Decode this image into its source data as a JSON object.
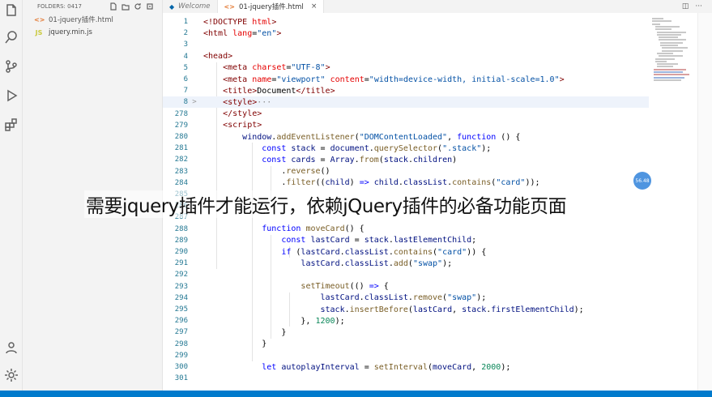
{
  "activity_bar": {
    "icons": [
      "explorer-icon",
      "search-icon",
      "source-control-icon",
      "run-debug-icon",
      "extensions-icon",
      "accounts-icon",
      "settings-gear-icon"
    ]
  },
  "sidebar": {
    "header": "FOLDERS: 0417",
    "files": [
      {
        "name": "01-jquery插件.html",
        "type": "html",
        "icon": "<>"
      },
      {
        "name": "jquery.min.js",
        "type": "js",
        "icon": "JS"
      }
    ]
  },
  "tabs": [
    {
      "label": "Welcome",
      "icon": "vscode-icon",
      "active": false
    },
    {
      "label": "01-jquery插件.html",
      "icon": "html-file-icon",
      "active": true,
      "close": "×"
    }
  ],
  "tab_actions": [
    "◫",
    "···"
  ],
  "code_lines": [
    {
      "n": "1",
      "fold": "",
      "html": "<span class=\"tg\">&lt;!DOCTYPE</span> <span class=\"at\">html</span><span class=\"tg\">&gt;</span>"
    },
    {
      "n": "2",
      "fold": "",
      "html": "<span class=\"tg\">&lt;html</span> <span class=\"at\">lang</span>=<span class=\"st\">\"en\"</span><span class=\"tg\">&gt;</span>"
    },
    {
      "n": "3",
      "fold": "",
      "html": ""
    },
    {
      "n": "4",
      "fold": "",
      "html": "<span class=\"tg\">&lt;head&gt;</span>"
    },
    {
      "n": "5",
      "fold": "",
      "html": "    <span class=\"tg\">&lt;meta</span> <span class=\"at\">charset</span>=<span class=\"st\">\"UTF-8\"</span><span class=\"tg\">&gt;</span>"
    },
    {
      "n": "6",
      "fold": "",
      "html": "    <span class=\"tg\">&lt;meta</span> <span class=\"at\">name</span>=<span class=\"st\">\"viewport\"</span> <span class=\"at\">content</span>=<span class=\"st\">\"width=device-width, initial-scale=1.0\"</span><span class=\"tg\">&gt;</span>"
    },
    {
      "n": "7",
      "fold": "",
      "html": "    <span class=\"tg\">&lt;title&gt;</span>Document<span class=\"tg\">&lt;/title&gt;</span>"
    },
    {
      "n": "8",
      "fold": ">",
      "html": "    <span class=\"tg\">&lt;style&gt;</span><span class=\"el\">···</span>",
      "current": true
    },
    {
      "n": "278",
      "fold": "",
      "html": "    <span class=\"tg\">&lt;/style&gt;</span>"
    },
    {
      "n": "279",
      "fold": "",
      "html": "    <span class=\"tg\">&lt;script&gt;</span>"
    },
    {
      "n": "280",
      "fold": "",
      "html": "        <span class=\"vr\">window</span>.<span class=\"fn\">addEventListener</span>(<span class=\"st\">\"DOMContentLoaded\"</span>, <span class=\"kw\">function</span> () {"
    },
    {
      "n": "281",
      "fold": "",
      "html": "            <span class=\"kw\">const</span> <span class=\"vr\">stack</span> = <span class=\"vr\">document</span>.<span class=\"fn\">querySelector</span>(<span class=\"st\">\".stack\"</span>);"
    },
    {
      "n": "282",
      "fold": "",
      "html": "            <span class=\"kw\">const</span> <span class=\"vr\">cards</span> = <span class=\"vr\">Array</span>.<span class=\"fn\">from</span>(<span class=\"vr\">stack</span>.<span class=\"vr\">children</span>)"
    },
    {
      "n": "283",
      "fold": "",
      "html": "                .<span class=\"fn\">reverse</span>()"
    },
    {
      "n": "284",
      "fold": "",
      "html": "                .<span class=\"fn\">filter</span>((<span class=\"vr\">child</span>) <span class=\"kw\">=&gt;</span> <span class=\"vr\">child</span>.<span class=\"vr\">classList</span>.<span class=\"fn\">contains</span>(<span class=\"st\">\"card\"</span>));"
    },
    {
      "n": "285",
      "fold": "",
      "html": ""
    },
    {
      "n": "286",
      "fold": "",
      "html": ""
    },
    {
      "n": "287",
      "fold": "",
      "html": ""
    },
    {
      "n": "288",
      "fold": "",
      "html": "            <span class=\"kw\">function</span> <span class=\"fn\">moveCard</span>() {"
    },
    {
      "n": "289",
      "fold": "",
      "html": "                <span class=\"kw\">const</span> <span class=\"vr\">lastCard</span> = <span class=\"vr\">stack</span>.<span class=\"vr\">lastElementChild</span>;"
    },
    {
      "n": "290",
      "fold": "",
      "html": "                <span class=\"kw\">if</span> (<span class=\"vr\">lastCard</span>.<span class=\"vr\">classList</span>.<span class=\"fn\">contains</span>(<span class=\"st\">\"card\"</span>)) {"
    },
    {
      "n": "291",
      "fold": "",
      "html": "                    <span class=\"vr\">lastCard</span>.<span class=\"vr\">classList</span>.<span class=\"fn\">add</span>(<span class=\"st\">\"swap\"</span>);"
    },
    {
      "n": "292",
      "fold": "",
      "html": ""
    },
    {
      "n": "293",
      "fold": "",
      "html": "                    <span class=\"fn\">setTimeout</span>(() <span class=\"kw\">=&gt;</span> {"
    },
    {
      "n": "294",
      "fold": "",
      "html": "                        <span class=\"vr\">lastCard</span>.<span class=\"vr\">classList</span>.<span class=\"fn\">remove</span>(<span class=\"st\">\"swap\"</span>);"
    },
    {
      "n": "295",
      "fold": "",
      "html": "                        <span class=\"vr\">stack</span>.<span class=\"fn\">insertBefore</span>(<span class=\"vr\">lastCard</span>, <span class=\"vr\">stack</span>.<span class=\"vr\">firstElementChild</span>);"
    },
    {
      "n": "296",
      "fold": "",
      "html": "                    }, <span class=\"nm\">1200</span>);"
    },
    {
      "n": "297",
      "fold": "",
      "html": "                }"
    },
    {
      "n": "298",
      "fold": "",
      "html": "            }"
    },
    {
      "n": "299",
      "fold": "",
      "html": ""
    },
    {
      "n": "300",
      "fold": "",
      "html": "            <span class=\"kw\">let</span> <span class=\"vr\">autoplayInterval</span> = <span class=\"fn\">setInterval</span>(<span class=\"vr\">moveCard</span>, <span class=\"nm\">2000</span>);"
    },
    {
      "n": "301",
      "fold": "",
      "html": ""
    }
  ],
  "caption": "需要jquery插件才能运行，依赖jQuery插件的必备功能页面",
  "float_badge": "56.48",
  "colors": {
    "activity_bar": "#f3f3f3",
    "status_bar": "#007acc",
    "line_number": "#237893",
    "current_line": "#eef3fb"
  }
}
